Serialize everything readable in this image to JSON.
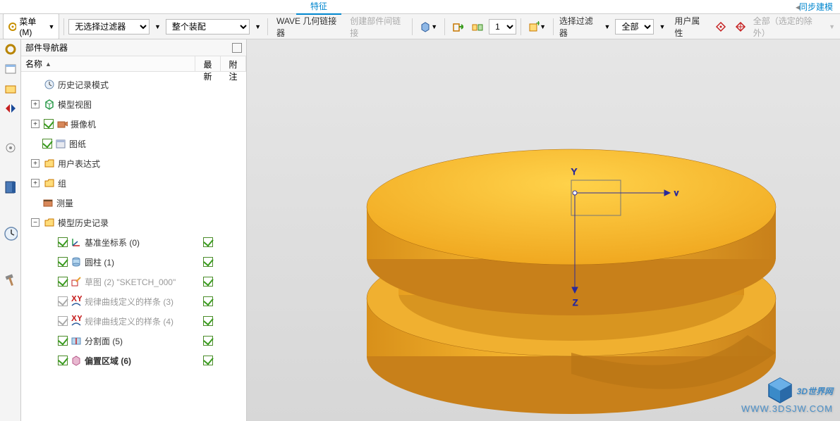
{
  "tabs": {
    "feature": "特征",
    "sync": "同步建模"
  },
  "toolbar": {
    "menu": "菜单(M)",
    "filter_sel": "无选择过滤器",
    "assembly_sel": "整个装配",
    "wave": "WAVE 几何链接器",
    "create_link": "创建部件间链接",
    "num": "1",
    "filter_label": "选择过滤器",
    "all_sel": "全部",
    "user_prop": "用户属性",
    "all_exclude": "全部（选定的除外）"
  },
  "nav": {
    "title": "部件导航器",
    "col_name": "名称",
    "col_latest": "最新",
    "col_note": "附注"
  },
  "tree": {
    "history_mode": "历史记录模式",
    "model_view": "模型视图",
    "camera": "摄像机",
    "drawing": "图纸",
    "user_expr": "用户表达式",
    "group": "组",
    "measure": "测量",
    "model_history": "模型历史记录",
    "datum": "基准坐标系 (0)",
    "cylinder": "圆柱 (1)",
    "sketch": "草图 (2) \"SKETCH_000\"",
    "law_spline1": "规律曲线定义的样条 (3)",
    "law_spline2": "规律曲线定义的样条 (4)",
    "split": "分割面 (5)",
    "offset": "偏置区域 (6)"
  },
  "watermark": {
    "main": "3D世界网",
    "sub": "WWW.3DSJW.COM"
  }
}
